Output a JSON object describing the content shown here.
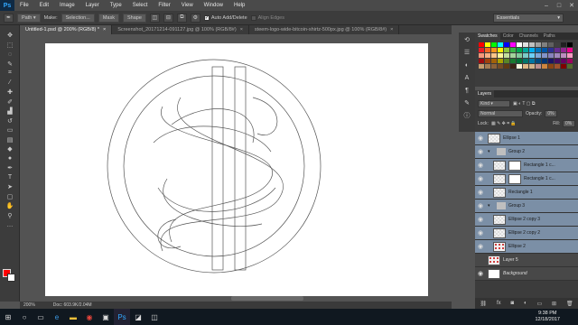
{
  "menubar": {
    "logo": "Ps",
    "items": [
      "File",
      "Edit",
      "Image",
      "Layer",
      "Type",
      "Select",
      "Filter",
      "View",
      "Window",
      "Help"
    ]
  },
  "options": {
    "mode": "Path",
    "make_label": "Make:",
    "selection_btn": "Selection...",
    "mask_btn": "Mask",
    "shape_btn": "Shape",
    "auto_add_delete": "Auto Add/Delete",
    "align_edges": "Align Edges",
    "workspace": "Essentials"
  },
  "tabs": [
    {
      "label": "Untitled-1.psd @ 200% (RGB/8) *",
      "active": true
    },
    {
      "label": "Screenshot_20171214-091127.jpg @ 100% (RGB/8#)",
      "active": false
    },
    {
      "label": "steem-logo-wide-bitcoin-shirtz-500px.jpg @ 100% (RGB/8#)",
      "active": false
    }
  ],
  "status": {
    "zoom": "200%",
    "doc": "Doc: 603.9K/2.04M"
  },
  "swatches_panel": {
    "tabs": [
      "Swatches",
      "Color",
      "Channels",
      "Paths"
    ],
    "colors": [
      "#ff0000",
      "#ffff00",
      "#00ff00",
      "#00ffff",
      "#0000ff",
      "#ff00ff",
      "#ffffff",
      "#e0e0e0",
      "#c0c0c0",
      "#a0a0a0",
      "#808080",
      "#606060",
      "#404040",
      "#202020",
      "#000000",
      "#ed1c24",
      "#f26522",
      "#f7941d",
      "#fff200",
      "#8dc63f",
      "#39b54a",
      "#00a651",
      "#00a99d",
      "#00aeef",
      "#0072bc",
      "#0054a6",
      "#2e3192",
      "#662d91",
      "#92278f",
      "#ec008c",
      "#f69679",
      "#f9ad81",
      "#fdc689",
      "#fff799",
      "#c4df9b",
      "#a3d39c",
      "#82ca9c",
      "#7accc8",
      "#6dcff6",
      "#7da7d9",
      "#8393ca",
      "#8781bd",
      "#a187be",
      "#bd8cbf",
      "#f49ac1",
      "#9e0b0f",
      "#a0410d",
      "#a36209",
      "#aba000",
      "#598527",
      "#1a7b30",
      "#007236",
      "#00746b",
      "#0076a3",
      "#004a80",
      "#003471",
      "#1b1464",
      "#440e62",
      "#630460",
      "#9e005d",
      "#c69c6d",
      "#a67c52",
      "#8c6239",
      "#754c24",
      "#603913",
      "#3c2415",
      "#f5f5dc",
      "#deb887",
      "#d2b48c",
      "#bc8f8f",
      "#cd853f",
      "#8b4513",
      "#a0522d",
      "#800000",
      "#556b2f"
    ]
  },
  "layers_panel": {
    "title": "Layers",
    "kind": "Kind",
    "blend_mode": "Normal",
    "opacity_label": "Opacity:",
    "opacity_value": "0%",
    "lock_label": "Lock:",
    "fill_label": "Fill:",
    "fill_value": "0%",
    "layers": [
      {
        "name": "Ellipse 1",
        "type": "layer",
        "selected": true,
        "indent": 0
      },
      {
        "name": "Group 2",
        "type": "group",
        "selected": true,
        "indent": 0
      },
      {
        "name": "Rectangle 1 c...",
        "type": "layer-mask",
        "selected": true,
        "indent": 1
      },
      {
        "name": "Rectangle 1 c...",
        "type": "layer-mask",
        "selected": true,
        "indent": 1
      },
      {
        "name": "Rectangle 1",
        "type": "layer",
        "selected": true,
        "indent": 1
      },
      {
        "name": "Group 3",
        "type": "group",
        "selected": true,
        "indent": 0
      },
      {
        "name": "Ellipse 2 copy 3",
        "type": "layer",
        "selected": true,
        "indent": 1
      },
      {
        "name": "Ellipse 2 copy 2",
        "type": "layer",
        "selected": true,
        "indent": 1
      },
      {
        "name": "Ellipse 2",
        "type": "layer-red",
        "selected": true,
        "indent": 1
      },
      {
        "name": "Layer 5",
        "type": "layer-red",
        "selected": false,
        "indent": 0
      },
      {
        "name": "Background",
        "type": "white",
        "selected": false,
        "indent": 0
      }
    ]
  },
  "taskbar": {
    "time": "9:38 PM",
    "date": "12/18/2017"
  },
  "colors": {
    "foreground": "#ff0000",
    "background": "#ffffff",
    "selection": "#7b8fa6"
  }
}
